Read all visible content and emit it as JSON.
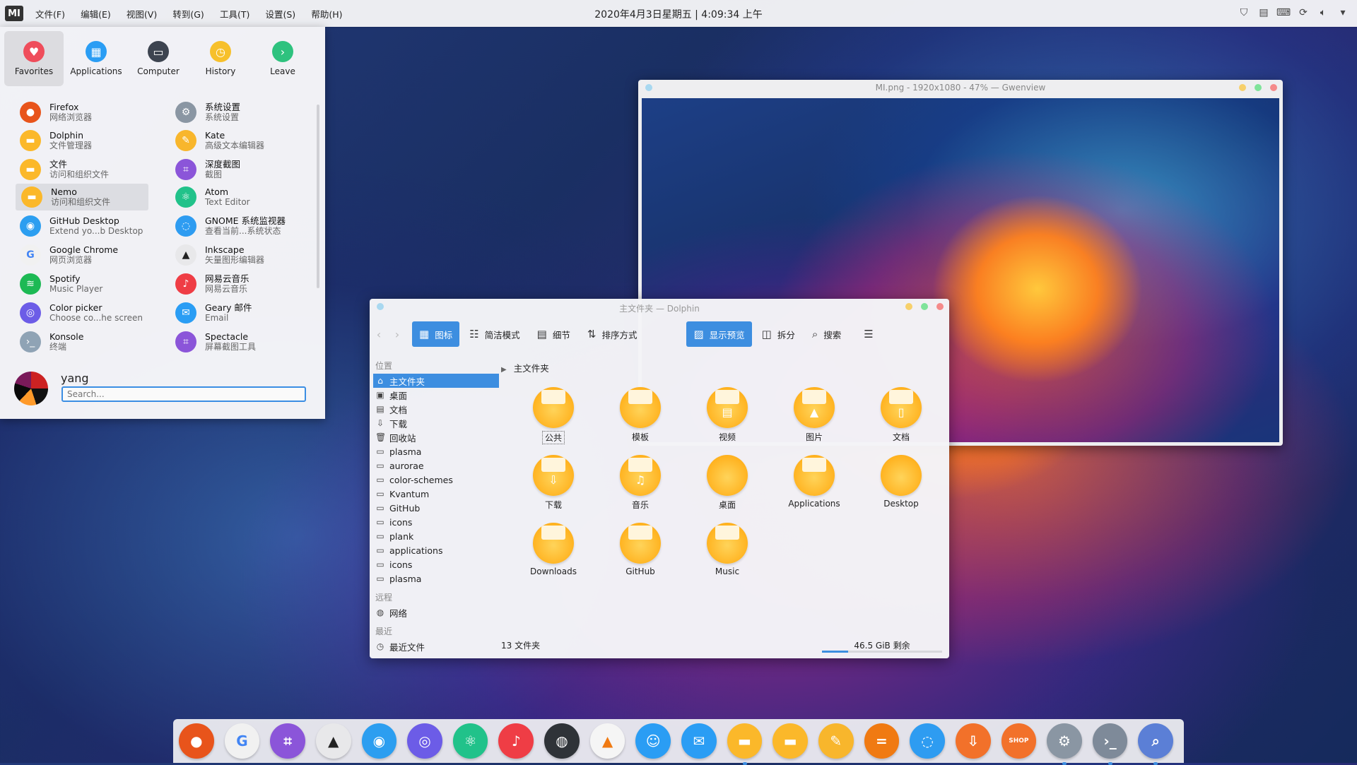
{
  "topbar": {
    "logo": "MI",
    "menus": [
      "文件(F)",
      "编辑(E)",
      "视图(V)",
      "转到(G)",
      "工具(T)",
      "设置(S)",
      "帮助(H)"
    ],
    "clock": "2020年4月3日星期五 | 4:09:34 上午"
  },
  "launcher": {
    "tabs": [
      "Favorites",
      "Applications",
      "Computer",
      "History",
      "Leave"
    ],
    "apps_left": [
      {
        "name": "Firefox",
        "sub": "网络浏览器"
      },
      {
        "name": "Dolphin",
        "sub": "文件管理器"
      },
      {
        "name": "文件",
        "sub": "访问和组织文件"
      },
      {
        "name": "Nemo",
        "sub": "访问和组织文件"
      },
      {
        "name": "GitHub Desktop",
        "sub": "Extend yo...b Desktop"
      },
      {
        "name": "Google Chrome",
        "sub": "网页浏览器"
      },
      {
        "name": "Spotify",
        "sub": "Music Player"
      },
      {
        "name": "Color picker",
        "sub": "Choose co...he screen"
      },
      {
        "name": "Konsole",
        "sub": "终端"
      }
    ],
    "apps_right": [
      {
        "name": "系统设置",
        "sub": "系统设置"
      },
      {
        "name": "Kate",
        "sub": "高级文本编辑器"
      },
      {
        "name": "深度截图",
        "sub": "截图"
      },
      {
        "name": "Atom",
        "sub": "Text Editor"
      },
      {
        "name": "GNOME 系统监视器",
        "sub": "查看当前...系统状态"
      },
      {
        "name": "Inkscape",
        "sub": "矢量图形编辑器"
      },
      {
        "name": "网易云音乐",
        "sub": "网易云音乐"
      },
      {
        "name": "Geary 邮件",
        "sub": "Email"
      },
      {
        "name": "Spectacle",
        "sub": "屏幕截图工具"
      }
    ],
    "user": "yang",
    "search_placeholder": "Search..."
  },
  "gwenview": {
    "title": "MI.png - 1920x1080 - 47% — Gwenview"
  },
  "dolphin": {
    "title": "主文件夹 — Dolphin",
    "toolbar": {
      "icons": "图标",
      "compact": "简洁模式",
      "details": "细节",
      "sort": "排序方式",
      "preview": "显示预览",
      "split": "拆分",
      "search": "搜索"
    },
    "places_header": "位置",
    "places": [
      "主文件夹",
      "桌面",
      "文档",
      "下载",
      "回收站",
      "plasma",
      "aurorae",
      "color-schemes",
      "Kvantum",
      "GitHub",
      "icons",
      "plank",
      "applications",
      "icons",
      "plasma"
    ],
    "remote_header": "远程",
    "remote": [
      "网络"
    ],
    "recent_header": "最近",
    "recent": [
      "最近文件"
    ],
    "breadcrumb": "主文件夹",
    "folders": [
      "公共",
      "模板",
      "视频",
      "图片",
      "文档",
      "下载",
      "音乐",
      "桌面",
      "Applications",
      "Desktop",
      "Downloads",
      "GitHub",
      "Music"
    ],
    "status": "13 文件夹",
    "free_space": "46.5 GiB 剩余",
    "used_fraction": 0.22
  },
  "dock": {
    "items": [
      "firefox",
      "chrome",
      "screenshot",
      "inkscape",
      "github",
      "color-picker",
      "atom",
      "netease-music",
      "aperture",
      "vlc",
      "qq",
      "mail",
      "files",
      "folder",
      "kate",
      "calculator",
      "monitor",
      "downloader",
      "shop",
      "settings",
      "terminal",
      "search"
    ],
    "shop_label": "SHOP"
  }
}
